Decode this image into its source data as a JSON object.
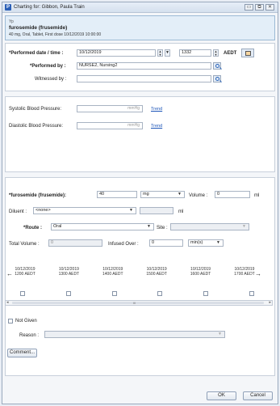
{
  "window": {
    "title": "Charting for: Gibbon, Paula Train",
    "app_icon": "P"
  },
  "order": {
    "type_label": "Yp",
    "drug_name": "furosemide (frusemide)",
    "details": "40 mg, Oral, Tablet, First dose 10/12/2019 10:00:00"
  },
  "performed": {
    "date_label": "*Performed date / time :",
    "date_value": "10/12/2019",
    "time_value": "1332",
    "timezone": "AEDT",
    "by_label": "*Performed by :",
    "by_value": "NURSE2, Nursing2",
    "witnessed_label": "Witnessed by :",
    "witnessed_value": ""
  },
  "vitals": {
    "systolic_label": "Systolic Blood Pressure:",
    "systolic_unit": "mmHg",
    "systolic_link": "Trend",
    "diastolic_label": "Diastolic Blood Pressure:",
    "diastolic_unit": "mmHg",
    "diastolic_link": "Trend"
  },
  "dose": {
    "drug_label": "*furosemide (frusemide):",
    "dose_value": "40",
    "dose_unit": "mg",
    "volume_label": "Volume :",
    "volume_value": "0",
    "volume_unit": "ml",
    "diluent_label": "Diluent :",
    "diluent_value": "<none>",
    "diluent_unit": "ml",
    "route_label": "*Route :",
    "route_value": "Oral",
    "site_label": "Site :",
    "site_value": "",
    "total_volume_label": "Total Volume :",
    "total_volume_value": "0",
    "infused_over_label": "Infused Over :",
    "infused_over_value": "0",
    "infused_over_unit": "min(s)"
  },
  "schedule": {
    "times": [
      {
        "date": "10/12/2019",
        "time": "1200 AEDT"
      },
      {
        "date": "10/12/2019",
        "time": "1300 AEDT"
      },
      {
        "date": "10/12/2019",
        "time": "1400 AEDT"
      },
      {
        "date": "10/12/2019",
        "time": "1500 AEDT"
      },
      {
        "date": "10/12/2019",
        "time": "1600 AEDT"
      },
      {
        "date": "10/12/2019",
        "time": "1700 AEDT"
      }
    ],
    "scroll_marker": "III"
  },
  "not_given": {
    "label": "Not Given",
    "reason_label": "Reason :",
    "reason_value": ""
  },
  "buttons": {
    "comment": "Comment...",
    "ok": "OK",
    "cancel": "Cancel"
  },
  "colors": {
    "banner_bg": "#e3eef8",
    "link": "#1b54b8",
    "title_icon": "#2b5fb6"
  }
}
